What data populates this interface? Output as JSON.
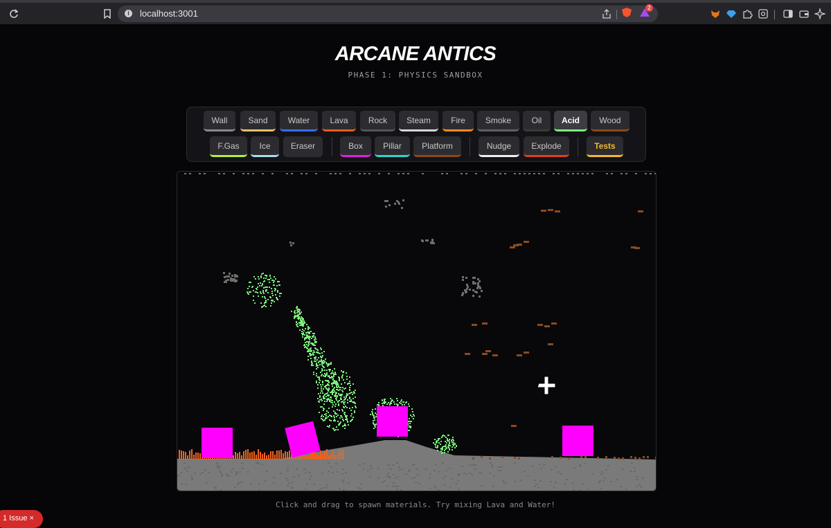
{
  "browser": {
    "url": "localhost:3001",
    "notification_count": "2"
  },
  "page": {
    "title": "ARCANE ANTICS",
    "subtitle": "PHASE 1: PHYSICS SANDBOX",
    "hint": "Click and drag to spawn materials. Try mixing Lava and Water!"
  },
  "toolbar": {
    "row1": [
      {
        "label": "Wall",
        "color": "#8a8a8a"
      },
      {
        "label": "Sand",
        "color": "#e8c06a"
      },
      {
        "label": "Water",
        "color": "#3a6cf0"
      },
      {
        "label": "Lava",
        "color": "#f05a1a"
      },
      {
        "label": "Rock",
        "color": "#555555"
      },
      {
        "label": "Steam",
        "color": "#d8d8d8"
      },
      {
        "label": "Fire",
        "color": "#ff8a1a"
      },
      {
        "label": "Smoke",
        "color": "#606060"
      },
      {
        "label": "Oil",
        "color": "#3a3a3a"
      },
      {
        "label": "Acid",
        "color": "#7cf07c"
      },
      {
        "label": "Wood",
        "color": "#8a4a1a"
      }
    ],
    "row2": [
      {
        "label": "F.Gas",
        "color": "#b6f03a"
      },
      {
        "label": "Ice",
        "color": "#a8dcf0"
      },
      {
        "label": "Eraser",
        "color": "#2c2c30"
      },
      {
        "label": "Box",
        "color": "#e020e0"
      },
      {
        "label": "Pillar",
        "color": "#2ad8d0"
      },
      {
        "label": "Platform",
        "color": "#8a4a1a"
      },
      {
        "label": "Nudge",
        "color": "#f0f0f0"
      },
      {
        "label": "Explode",
        "color": "#e0401a"
      },
      {
        "label": "Tests",
        "color": "#f5b82e"
      }
    ],
    "active": "Acid"
  },
  "colors": {
    "acid": "#7cf07c",
    "box": "#ff00ff",
    "lava": "#f0641e",
    "wood": "#8a4a22",
    "smoke": "#6e6e6e",
    "ground": "#7a7a7a"
  },
  "status": {
    "issues": "1 Issue"
  }
}
